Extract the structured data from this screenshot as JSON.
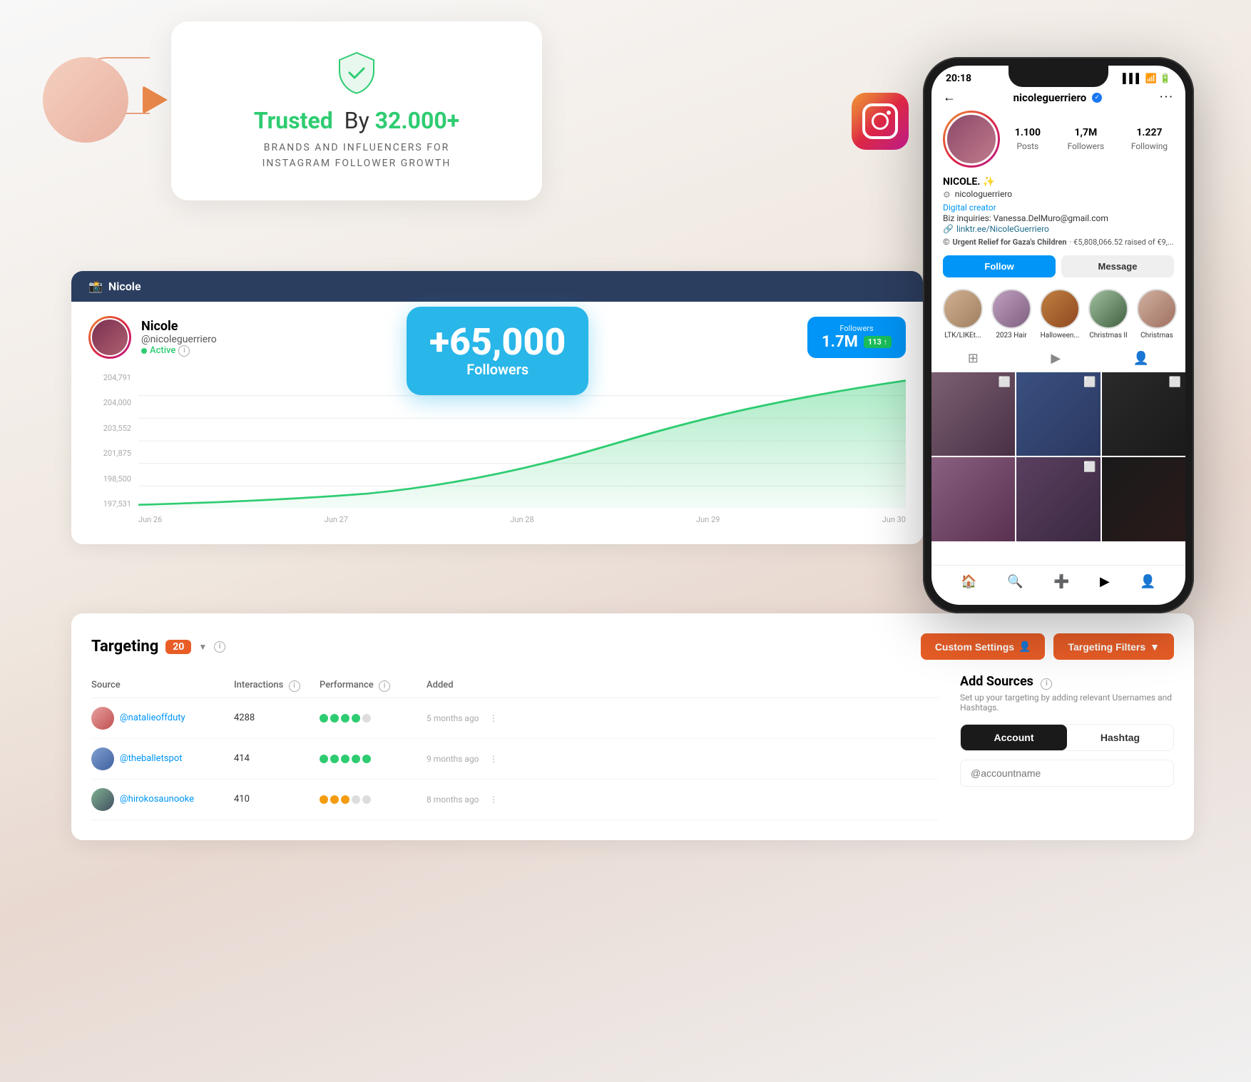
{
  "trust_card": {
    "title_1": "Trusted",
    "title_2": "By",
    "number": "32.000+",
    "subtitle_line1": "BRANDS AND INFLUENCERS FOR",
    "subtitle_line2": "INSTAGRAM FOLLOWER GROWTH"
  },
  "followers_bubble": {
    "number": "+65,000",
    "label": "Followers"
  },
  "phone": {
    "status_time": "20:18",
    "username": "nicoleguerriero",
    "back_icon": "←",
    "more_icon": "···",
    "stats": {
      "posts_value": "1.100",
      "posts_label": "Posts",
      "followers_value": "1,7M",
      "followers_label": "Followers",
      "following_value": "1.227",
      "following_label": "Following"
    },
    "display_name": "NICOLE. ✨",
    "handle_label": "nicologuerriero",
    "bio_role": "Digital creator",
    "bio_email": "Biz inquiries: Vanessa.DelMuro@gmail.com",
    "bio_link": "linktr.ee/NicoleGuerriero",
    "fundraiser_text": "Urgent Relief for Gaza's Children",
    "fundraiser_amount": "· €5,808,066.52 raised of €9,...",
    "btn_follow": "Follow",
    "btn_message": "Message",
    "highlights": [
      {
        "label": "LTK/LIKEt..."
      },
      {
        "label": "2023 Hair"
      },
      {
        "label": "Halloween..."
      },
      {
        "label": "Christmas II"
      },
      {
        "label": "Christmas"
      }
    ]
  },
  "dashboard": {
    "header_ig_label": "Nicole",
    "profile_name": "Nicole",
    "profile_handle": "@nicoleguerriero",
    "profile_status": "Active",
    "followers_label": "Followers",
    "followers_value": "1.7M",
    "followers_change": "113 ↑",
    "chart": {
      "y_labels": [
        "204,791",
        "204,000",
        "203,552",
        "201,875",
        "198,500",
        "197,531"
      ],
      "x_labels": [
        "Jun 26",
        "Jun 27",
        "Jun 28",
        "Jun 29",
        "Jun 30"
      ]
    }
  },
  "targeting": {
    "title": "Targeting",
    "count": "20",
    "btn_custom_settings": "Custom Settings",
    "btn_targeting_filters": "Targeting Filters",
    "table_headers": {
      "source": "Source",
      "interactions": "Interactions",
      "performance": "Performance",
      "added": "Added"
    },
    "rows": [
      {
        "handle": "@natalieoffduty",
        "interactions": "4288",
        "performance_dots": [
          1,
          1,
          1,
          1,
          0
        ],
        "added": "5 months ago"
      },
      {
        "handle": "@theballetspot",
        "interactions": "414",
        "performance_dots": [
          1,
          1,
          1,
          1,
          1
        ],
        "added": "9 months ago"
      },
      {
        "handle": "@hirokosaunooke",
        "interactions": "410",
        "performance_dots": [
          2,
          2,
          2,
          0,
          0
        ],
        "added": "8 months ago"
      }
    ],
    "add_sources_title": "Add Sources",
    "add_sources_subtitle": "Set up your targeting by adding relevant Usernames and Hashtags.",
    "tab_account": "Account",
    "tab_hashtag": "Hashtag",
    "input_placeholder": "@accountname"
  }
}
